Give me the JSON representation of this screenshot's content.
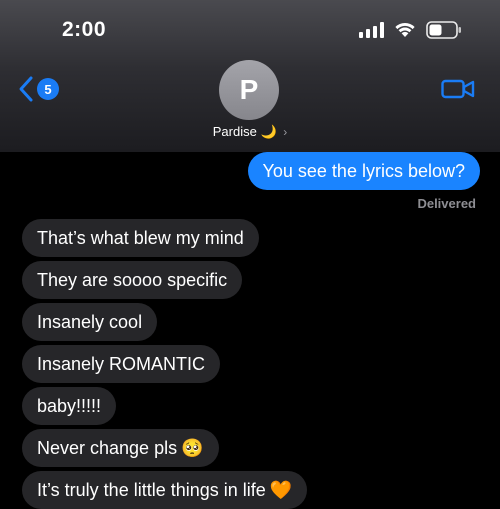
{
  "status_bar": {
    "time": "2:00"
  },
  "header": {
    "back_badge": "5",
    "avatar_initial": "P",
    "contact_name": "Pardise",
    "contact_emoji": "🌙",
    "chevron": "›"
  },
  "messages": {
    "outgoing": [
      {
        "text": "You see the lyrics below?"
      }
    ],
    "delivered_label": "Delivered",
    "incoming": [
      {
        "text": "That’s what blew my mind"
      },
      {
        "text": "They are soooo specific"
      },
      {
        "text": "Insanely cool"
      },
      {
        "text": "Insanely ROMANTIC"
      },
      {
        "text": "baby!!!!!"
      },
      {
        "text": "Never change pls",
        "emoji": "🥺"
      },
      {
        "text": "It’s truly the little things in life",
        "emoji": "🧡"
      }
    ]
  },
  "colors": {
    "outgoing_bubble": "#1a84ff",
    "incoming_bubble": "#262629",
    "accent": "#1a7cf5"
  },
  "icons": [
    "chevron-left-icon",
    "video-camera-icon",
    "signal-icon",
    "wifi-icon",
    "battery-icon"
  ]
}
